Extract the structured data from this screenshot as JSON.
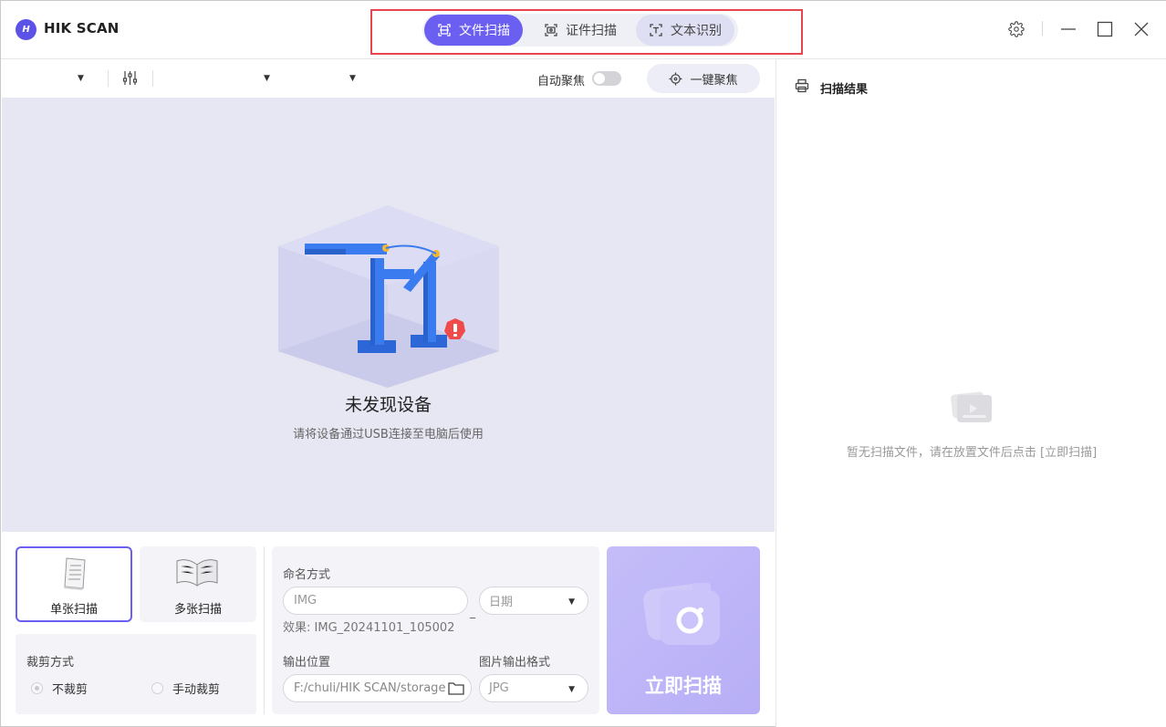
{
  "app": {
    "logo_text": "H",
    "title": "HIK SCAN"
  },
  "mode_tabs": [
    {
      "label": "文件扫描",
      "icon": "document-scan-icon",
      "active": true
    },
    {
      "label": "证件扫描",
      "icon": "id-scan-icon",
      "active": false
    },
    {
      "label": "文本识别",
      "icon": "text-recognition-icon",
      "active": false
    }
  ],
  "window_controls": [
    "gear-icon",
    "minimize-icon",
    "maximize-icon",
    "close-icon"
  ],
  "toolbar": {
    "auto_focus_label": "自动聚焦",
    "auto_focus_on": false,
    "one_key_focus_label": "一键聚焦"
  },
  "preview": {
    "title": "未发现设备",
    "subtitle": "请将设备通过USB连接至电脑后使用"
  },
  "scan_modes": {
    "single": "单张扫描",
    "multi": "多张扫描",
    "selected": "single"
  },
  "crop": {
    "title": "裁剪方式",
    "options": [
      "不裁剪",
      "手动裁剪"
    ],
    "selected": "不裁剪"
  },
  "naming": {
    "title": "命名方式",
    "prefix_placeholder": "IMG",
    "separator": "_",
    "date_select": "日期",
    "effect": "效果: IMG_20241101_105002"
  },
  "output": {
    "location_label": "输出位置",
    "location_value": "F:/chuli/HIK SCAN/storage",
    "format_label": "图片输出格式",
    "format_value": "JPG"
  },
  "scan_button": "立即扫描",
  "results": {
    "title": "扫描结果",
    "empty_text": "暂无扫描文件，请在放置文件后点击 [立即扫描]"
  },
  "colors": {
    "accent": "#6b5ff1",
    "highlight_box": "#e8464e",
    "preview_bg": "#e7e7f3",
    "device_blue": "#2f6fe0",
    "warning_red": "#f04b4b"
  }
}
